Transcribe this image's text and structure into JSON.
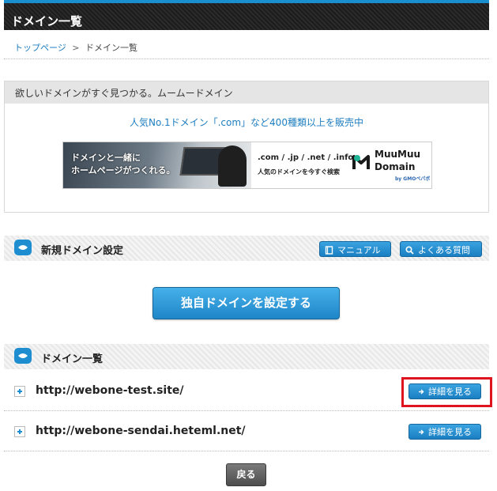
{
  "page": {
    "title": "ドメイン一覧"
  },
  "breadcrumb": {
    "home": "トップページ",
    "separator": ">",
    "current": "ドメイン一覧"
  },
  "promo": {
    "heading": "欲しいドメインがすぐ見つかる。ムームードメイン",
    "link_text": "人気No.1ドメイン「.com」など400種類以上を販売中",
    "banner": {
      "tagline_line1": "ドメインと一緒に",
      "tagline_line2": "ホームページがつくれる。",
      "tlds": ".com / .jp / .net / .info",
      "subtext": "人気のドメインを今すぐ検索",
      "brand_line1": "MuuMuu",
      "brand_line2": "Domain",
      "brand_by": "by GMOペパボ"
    }
  },
  "new_domain": {
    "section_title": "新規ドメイン設定",
    "manual_label": "マニュアル",
    "faq_label": "よくある質問",
    "setup_button": "独自ドメインを設定する"
  },
  "domain_list": {
    "section_title": "ドメイン一覧",
    "items": [
      {
        "domain": "http://webone-test.site/",
        "detail_label": "詳細を見る"
      },
      {
        "domain": "http://webone-sendai.heteml.net/",
        "detail_label": "詳細を見る"
      }
    ]
  },
  "back_button": "戻る",
  "colors": {
    "accent_blue": "#1f8ed0",
    "highlight_red": "#e0141e",
    "title_bar": "#1c1c1c"
  }
}
